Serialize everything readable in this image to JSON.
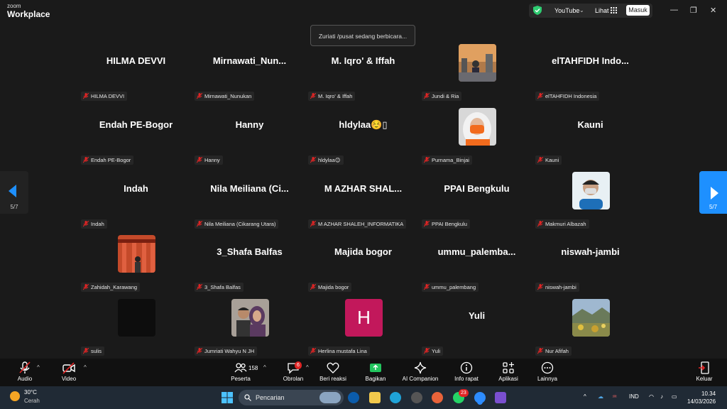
{
  "titlebar": {
    "brand_small": "zoom",
    "brand_big": "Workplace",
    "youtube_label": "YouTube",
    "view_label": "Lihat",
    "login_label": "Masuk",
    "shield_color": "#2ecc71"
  },
  "toast": {
    "text": "Zuriati /pusat sedang berbicara..."
  },
  "participants": [
    {
      "name": "HILMA DEVVI",
      "label": "HILMA DEVVI"
    },
    {
      "name": "Mirnawati_Nun...",
      "label": "Mirnawati_Nunukan"
    },
    {
      "name": "M. Iqro' & Iffah",
      "label": "M. Iqro' & Iffah"
    },
    {
      "name": "",
      "label": "Jundi & Ria"
    },
    {
      "name": "elTAHFIDH  Indo...",
      "label": "elTAHFIDH Indonesia"
    },
    {
      "name": "Endah PE-Bogor",
      "label": "Endah PE-Bogor"
    },
    {
      "name": "Hanny",
      "label": "Hanny"
    },
    {
      "name": "hldylaa☺️▯",
      "label": "hldylaa😊"
    },
    {
      "name": "",
      "label": "Purnama_Binjai"
    },
    {
      "name": "Kauni",
      "label": "Kauni"
    },
    {
      "name": "Indah",
      "label": "Indah"
    },
    {
      "name": "Nila  Meiliana  (Ci...",
      "label": "Nila Meiliana (Cikarang Utara)"
    },
    {
      "name": "M  AZHAR  SHAL...",
      "label": "M AZHAR SHALEH_INFORMATIKA"
    },
    {
      "name": "PPAI Bengkulu",
      "label": "PPAI Bengkulu"
    },
    {
      "name": "",
      "label": "Makmuri Albazah"
    },
    {
      "name": "",
      "label": "Zahidah_Karawang"
    },
    {
      "name": "3_Shafa Balfas",
      "label": "3_Shafa Balfas"
    },
    {
      "name": "Majida bogor",
      "label": "Majida bogor"
    },
    {
      "name": "ummu_palemba...",
      "label": "ummu_palembang"
    },
    {
      "name": "niswah-jambi",
      "label": "niswah-jambi"
    },
    {
      "name": "",
      "label": "sulis"
    },
    {
      "name": "",
      "label": "Jumriati Wahyu N JH"
    },
    {
      "name": "",
      "label": "Herlina mustafa Lina",
      "avatar_letter": "H"
    },
    {
      "name": "Yuli",
      "label": "Yuli"
    },
    {
      "name": "",
      "label": "Nur Afifah"
    }
  ],
  "nav": {
    "page_left": "5/7",
    "page_right": "5/7"
  },
  "toolbar": {
    "audio": "Audio",
    "video": "Video",
    "participants": "Peserta",
    "participants_count": "158",
    "chat": "Obrolan",
    "chat_badge": "6",
    "reactions": "Beri reaksi",
    "share": "Bagikan",
    "ai": "AI Companion",
    "info": "Info rapat",
    "apps": "Aplikasi",
    "more": "Lainnya",
    "leave": "Keluar",
    "share_color": "#22c55e",
    "leave_color": "#e02424"
  },
  "taskbar": {
    "temperature": "30°C",
    "condition": "Cerah",
    "search_placeholder": "Pencarian",
    "whatsapp_badge": "23",
    "language": "IND",
    "time": "10.34",
    "date": "14/03/2026"
  }
}
